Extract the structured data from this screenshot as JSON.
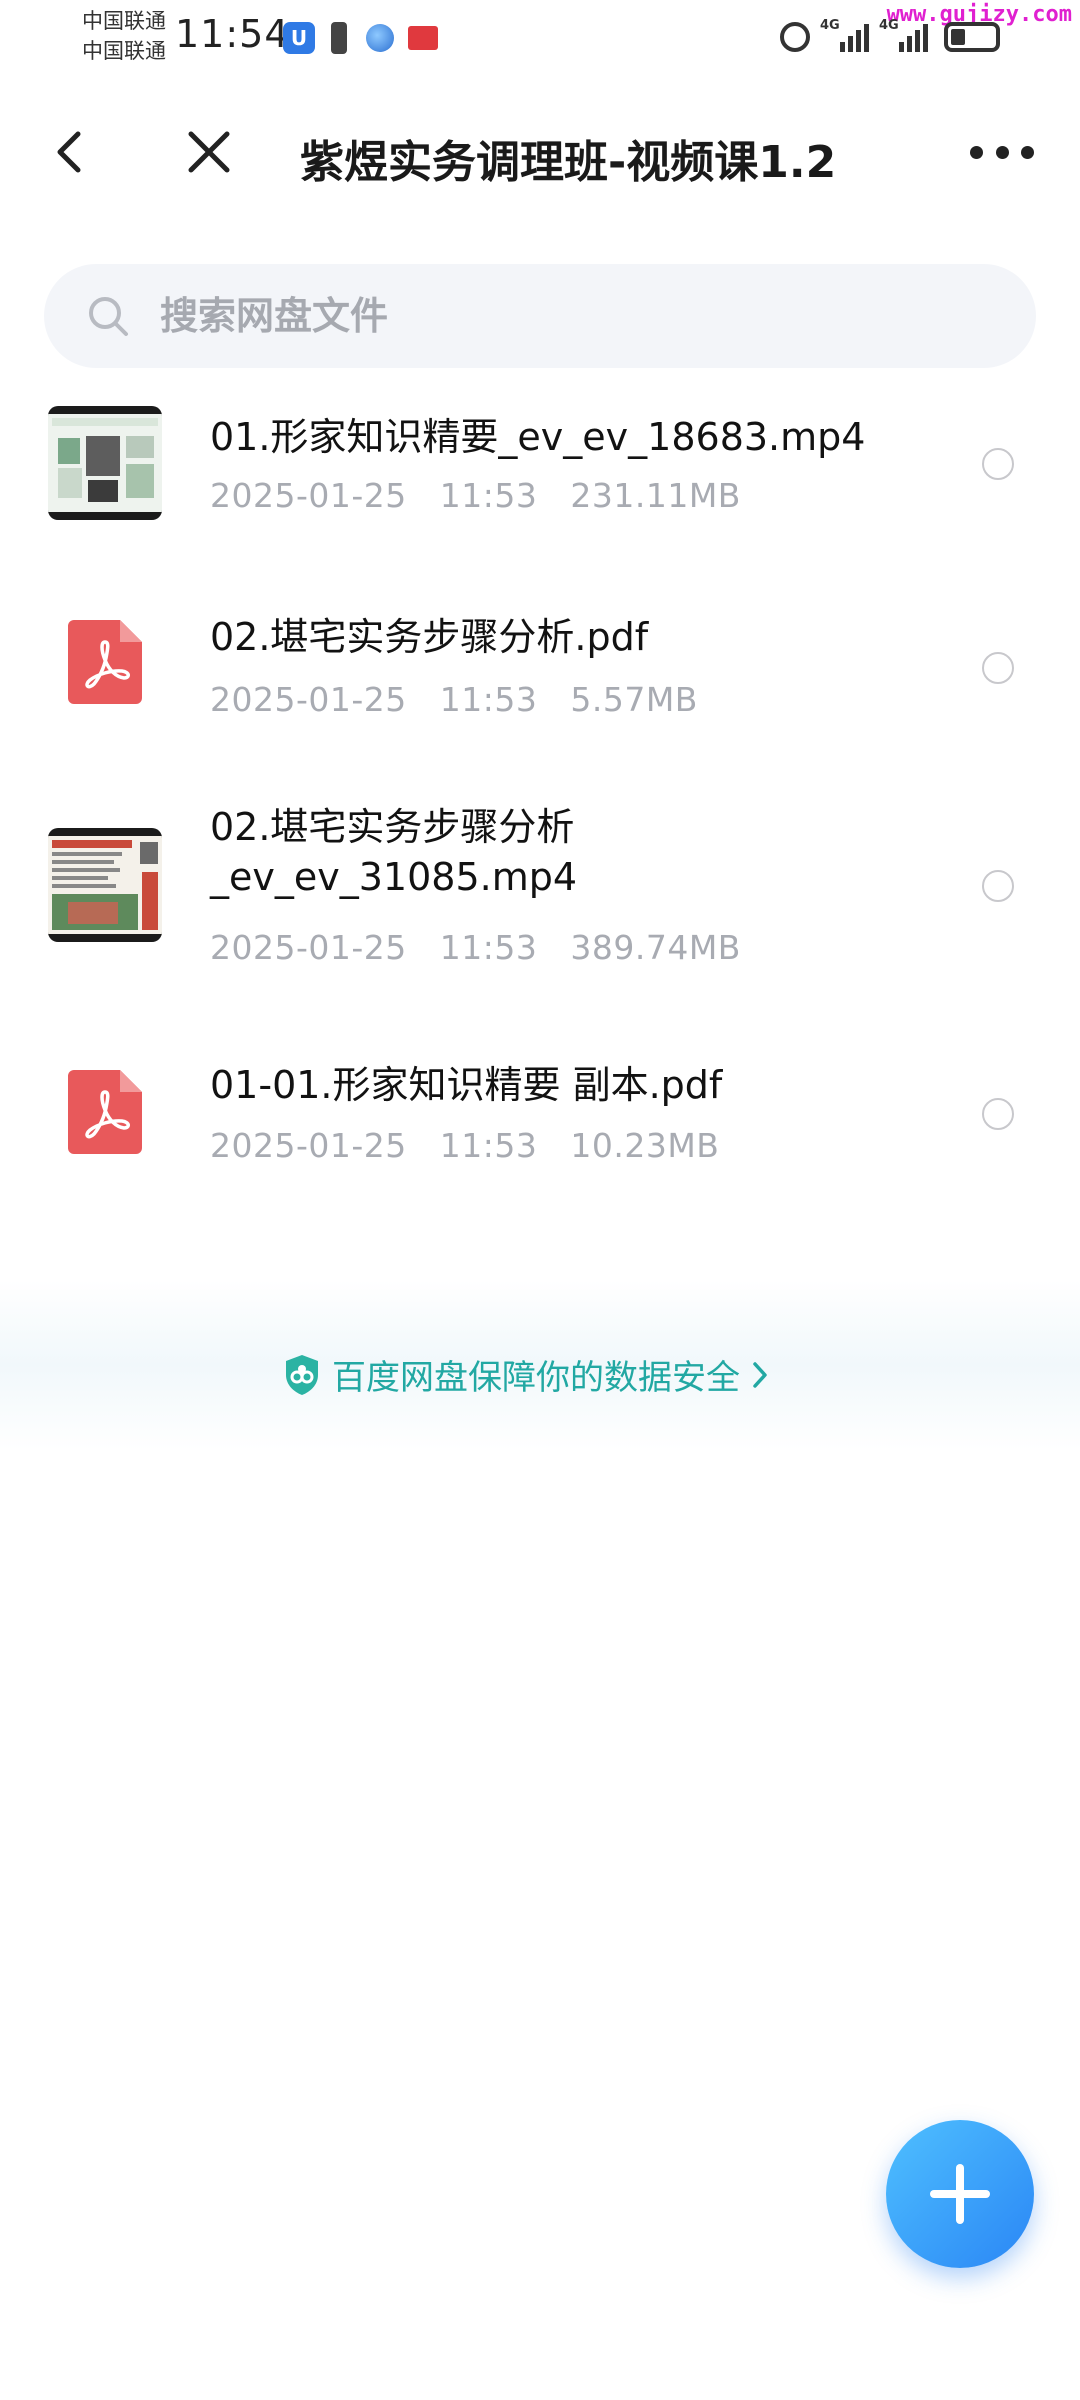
{
  "status_bar": {
    "carrier_1": "中国联通",
    "carrier_2": "中国联通",
    "time": "11:54",
    "network_1": "4G",
    "network_2": "4G",
    "watermark": "www.gujizy.com"
  },
  "header": {
    "title": "紫煜实务调理班-视频课1.2"
  },
  "search": {
    "placeholder": "搜索网盘文件"
  },
  "files": [
    {
      "name": "01.形家知识精要_ev_ev_18683.mp4",
      "date": "2025-01-25",
      "time": "11:53",
      "size": "231.11MB",
      "type": "video"
    },
    {
      "name": "02.堪宅实务步骤分析.pdf",
      "date": "2025-01-25",
      "time": "11:53",
      "size": "5.57MB",
      "type": "pdf"
    },
    {
      "name": "02.堪宅实务步骤分析_ev_ev_31085.mp4",
      "date": "2025-01-25",
      "time": "11:53",
      "size": "389.74MB",
      "type": "video"
    },
    {
      "name": "01-01.形家知识精要 副本.pdf",
      "date": "2025-01-25",
      "time": "11:53",
      "size": "10.23MB",
      "type": "pdf"
    }
  ],
  "security_banner": {
    "text": "百度网盘保障你的数据安全"
  },
  "colors": {
    "accent": "#2a86f5",
    "security_text": "#22a8a3",
    "pdf_red": "#e8595b"
  }
}
